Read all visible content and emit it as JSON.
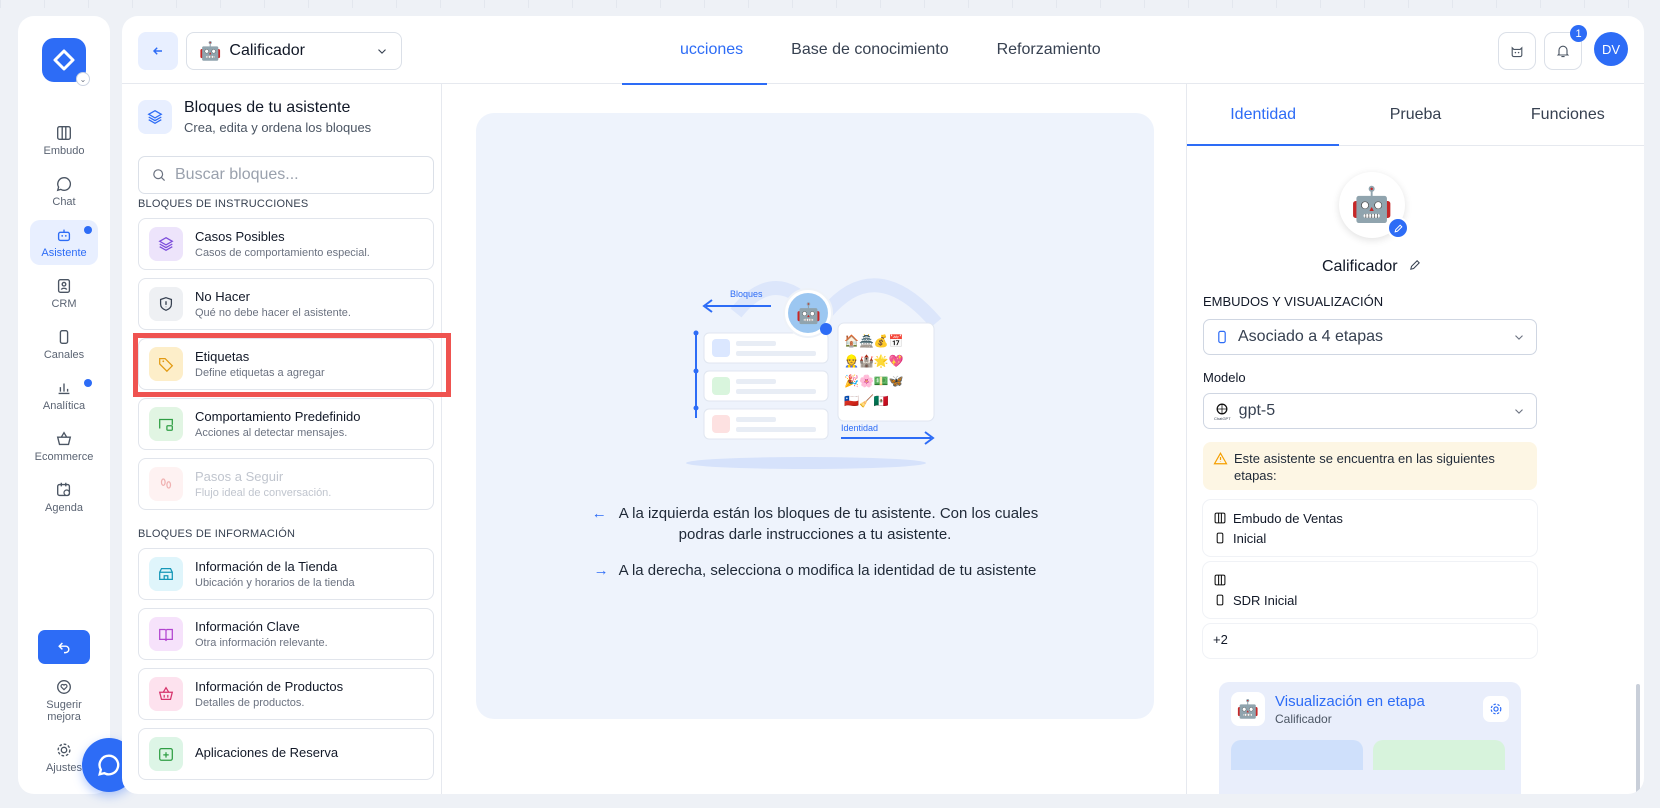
{
  "nav": {
    "items": [
      {
        "label": "Embudo"
      },
      {
        "label": "Chat"
      },
      {
        "label": "Asistente"
      },
      {
        "label": "CRM"
      },
      {
        "label": "Canales"
      },
      {
        "label": "Analítica"
      },
      {
        "label": "Ecommerce"
      },
      {
        "label": "Agenda"
      }
    ],
    "suggest": "Sugerir\nmejora",
    "settings": "Ajustes"
  },
  "topbar": {
    "assistant_emoji": "🤖",
    "assistant_name": "Calificador",
    "tabs": [
      "ucciones",
      "Base de conocimiento",
      "Reforzamiento"
    ],
    "notifications": "1",
    "avatar": "DV"
  },
  "blocks": {
    "title": "Bloques de tu asistente",
    "subtitle": "Crea, edita y ordena los bloques",
    "search_placeholder": "Buscar bloques...",
    "section_instructions": "BLOQUES DE INSTRUCCIONES",
    "instructions": [
      {
        "title": "Casos Posibles",
        "subtitle": "Casos de comportamiento especial."
      },
      {
        "title": "No Hacer",
        "subtitle": "Qué no debe hacer el asistente."
      },
      {
        "title": "Etiquetas",
        "subtitle": "Define etiquetas a agregar"
      },
      {
        "title": "Comportamiento Predefinido",
        "subtitle": "Acciones al detectar mensajes."
      },
      {
        "title": "Pasos a Seguir",
        "subtitle": "Flujo ideal de conversación."
      }
    ],
    "section_information": "BLOQUES DE INFORMACIÓN",
    "information": [
      {
        "title": "Información de la Tienda",
        "subtitle": "Ubicación y horarios de la tienda"
      },
      {
        "title": "Información Clave",
        "subtitle": "Otra información relevante."
      },
      {
        "title": "Información de Productos",
        "subtitle": "Detalles de productos."
      },
      {
        "title": "Aplicaciones de Reserva",
        "subtitle": ""
      }
    ]
  },
  "center": {
    "illus_left_label": "Bloques",
    "illus_right_label": "Identidad",
    "hint_left_1": "A la izquierda están los bloques de tu asistente. Con los cuales",
    "hint_left_2": "podras darle instrucciones a tu asistente.",
    "hint_right": "A la derecha, selecciona o modifica la identidad de tu asistente"
  },
  "right": {
    "tabs": [
      "Identidad",
      "Prueba",
      "Funciones"
    ],
    "bot_emoji": "🤖",
    "bot_name": "Calificador",
    "funnels_label": "EMBUDOS Y VISUALIZACIÓN",
    "funnels_value": "Asociado a 4 etapas",
    "model_label": "Modelo",
    "model_value": "gpt-5",
    "model_icon_caption": "ChatGPT",
    "warning": "Este asistente se encuentra en las siguientes etapas:",
    "stages": [
      {
        "funnel": "Embudo de Ventas",
        "stage": "Inicial"
      },
      {
        "funnel": "",
        "stage": "SDR Inicial"
      }
    ],
    "more": "+2",
    "visualization_title": "Visualización en etapa",
    "visualization_sub": "Calificador"
  },
  "colors": {
    "accent": "#2d6cf6",
    "highlight": "#ef5350",
    "warning_bg": "#fdf6e4"
  }
}
